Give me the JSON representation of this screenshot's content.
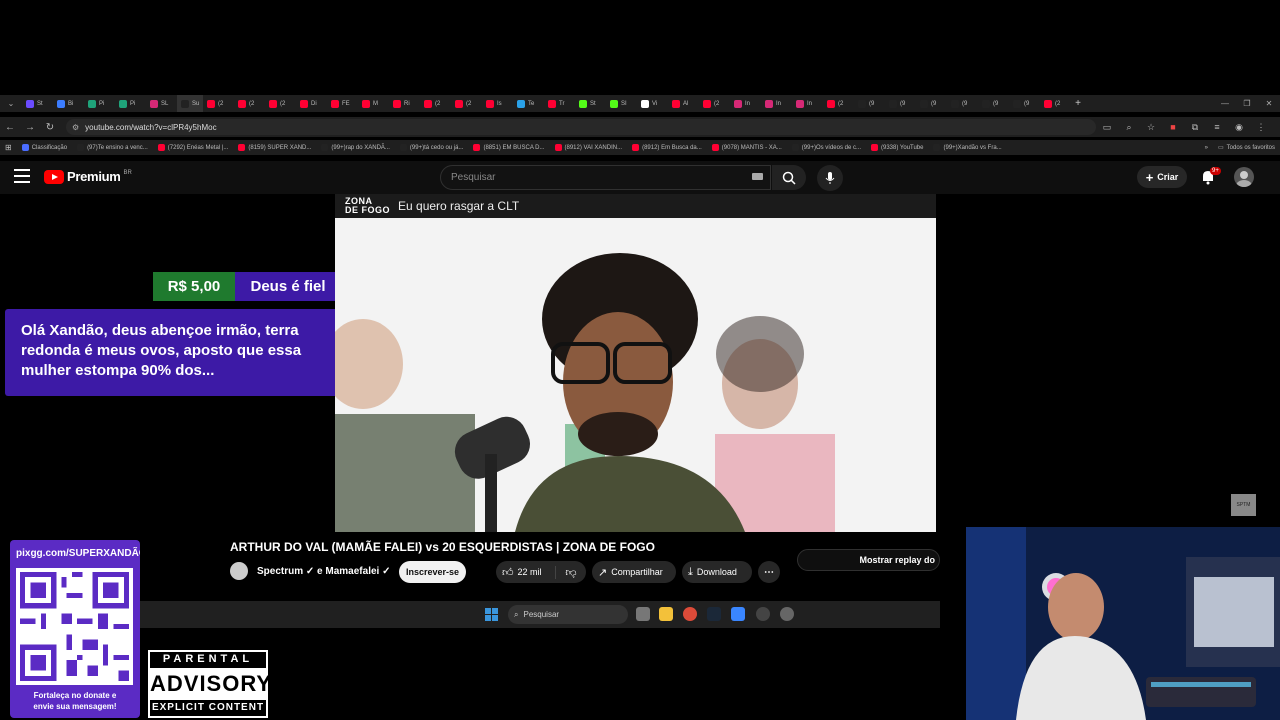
{
  "browser": {
    "tabs": [
      {
        "label": "St",
        "color": "#6b4cff"
      },
      {
        "label": "Bi",
        "color": "#3c7dff"
      },
      {
        "label": "Pi",
        "color": "#1fa37a"
      },
      {
        "label": "Pi",
        "color": "#1fa37a"
      },
      {
        "label": "SL",
        "color": "#d62976"
      },
      {
        "label": "Su",
        "color": "#222222"
      },
      {
        "label": "(2",
        "color": "#ff0033"
      },
      {
        "label": "(2",
        "color": "#ff0033"
      },
      {
        "label": "(2",
        "color": "#ff0033"
      },
      {
        "label": "Di",
        "color": "#ff0033"
      },
      {
        "label": "FE",
        "color": "#ff0033"
      },
      {
        "label": "M",
        "color": "#ff0033"
      },
      {
        "label": "Ri",
        "color": "#ff0033"
      },
      {
        "label": "(2",
        "color": "#ff0033"
      },
      {
        "label": "(2",
        "color": "#ff0033"
      },
      {
        "label": "Is",
        "color": "#ff0033"
      },
      {
        "label": "Te",
        "color": "#2aa1e8"
      },
      {
        "label": "Tr",
        "color": "#ff0033"
      },
      {
        "label": "St",
        "color": "#53fc18"
      },
      {
        "label": "SI",
        "color": "#53fc18"
      },
      {
        "label": "Vi",
        "color": "#ffffff"
      },
      {
        "label": "Al",
        "color": "#ff0033"
      },
      {
        "label": "(2",
        "color": "#ff0033"
      },
      {
        "label": "In",
        "color": "#d62976"
      },
      {
        "label": "In",
        "color": "#d62976"
      },
      {
        "label": "In",
        "color": "#d62976"
      },
      {
        "label": "(2",
        "color": "#ff0033"
      },
      {
        "label": "(9",
        "color": "#222222"
      },
      {
        "label": "(9",
        "color": "#222222"
      },
      {
        "label": "(9",
        "color": "#222222"
      },
      {
        "label": "(9",
        "color": "#222222"
      },
      {
        "label": "(9",
        "color": "#222222"
      },
      {
        "label": "(9",
        "color": "#222222"
      },
      {
        "label": "(2",
        "color": "#ff0033"
      }
    ],
    "url": "youtube.com/watch?v=clPR4y5hMoc",
    "bookmarks": [
      {
        "label": "Classificação",
        "color": "#4a6cff"
      },
      {
        "label": "(97)Te ensino a venc...",
        "color": "#222222"
      },
      {
        "label": "(7292) Enéas Metal |...",
        "color": "#ff0033"
      },
      {
        "label": "(8159) SUPER XAND...",
        "color": "#ff0033"
      },
      {
        "label": "(99+)rap do XANDÃ...",
        "color": "#222222"
      },
      {
        "label": "(99+)tá cedo ou já...",
        "color": "#222222"
      },
      {
        "label": "(8851) EM BUSCA D...",
        "color": "#ff0033"
      },
      {
        "label": "(8912) VAI XANDIN...",
        "color": "#ff0033"
      },
      {
        "label": "(8912) Em Busca da...",
        "color": "#ff0033"
      },
      {
        "label": "(9078) MANTIS - XA...",
        "color": "#ff0033"
      },
      {
        "label": "(99+)Os vídeos de c...",
        "color": "#222222"
      },
      {
        "label": "(9338) YouTube",
        "color": "#ff0033"
      },
      {
        "label": "(99+)Xandão vs Fra...",
        "color": "#222222"
      }
    ],
    "all_bookmarks": "Todos os favoritos"
  },
  "youtube": {
    "logo": "Premium",
    "region": "BR",
    "search_placeholder": "Pesquisar",
    "create_label": "Criar",
    "notif_count": "9+",
    "video_banner_logo_line1": "ZONA",
    "video_banner_logo_line2": "DE FOGO",
    "video_banner_text": "Eu quero rasgar a CLT",
    "video_title": "ARTHUR DO VAL (MAMÃE FALEI) vs 20 ESQUERDISTAS | ZONA DE FOGO",
    "channels": "Spectrum ✓ e Mamaefalei ✓",
    "subscribe_label": "Inscrever-se",
    "likes": "22 mil",
    "share_label": "Compartilhar",
    "download_label": "Download",
    "chat_replay_label": "Mostrar replay do"
  },
  "donation": {
    "amount": "R$ 5,00",
    "name": "Deus é fiel",
    "message": "Olá Xandão, deus abençoe irmão, terra redonda é meus ovos, aposto que essa mulher estompa 90% dos..."
  },
  "qr_panel": {
    "url": "pixgg.com/SUPERXANDÃO",
    "caption_line1": "Fortaleça no donate e",
    "caption_line2": "envie sua mensagem!"
  },
  "advisory": {
    "top": "PARENTAL",
    "middle": "ADVISORY",
    "bottom": "EXPLICIT CONTENT"
  },
  "taskbar": {
    "search_placeholder": "Pesquisar"
  },
  "channel_badge": "SPTM"
}
